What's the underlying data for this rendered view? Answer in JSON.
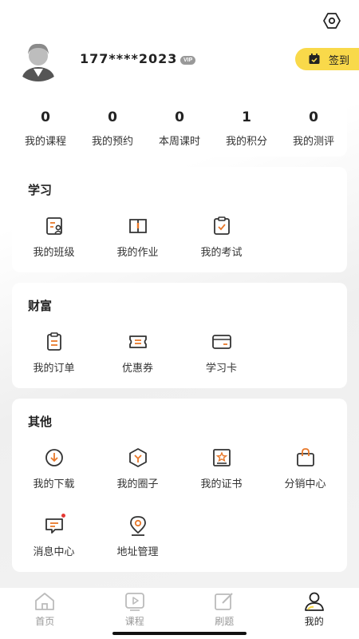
{
  "profile": {
    "username": "177****2023",
    "vip_badge": "VIP",
    "checkin_label": "签到"
  },
  "stats": [
    {
      "value": "0",
      "label": "我的课程"
    },
    {
      "value": "0",
      "label": "我的预约"
    },
    {
      "value": "0",
      "label": "本周课时"
    },
    {
      "value": "1",
      "label": "我的积分"
    },
    {
      "value": "0",
      "label": "我的测评"
    }
  ],
  "study": {
    "title": "学习",
    "items": [
      {
        "label": "我的班级",
        "icon": "class-icon"
      },
      {
        "label": "我的作业",
        "icon": "homework-icon"
      },
      {
        "label": "我的考试",
        "icon": "exam-icon"
      }
    ]
  },
  "wealth": {
    "title": "财富",
    "items": [
      {
        "label": "我的订单",
        "icon": "order-icon"
      },
      {
        "label": "优惠券",
        "icon": "coupon-icon"
      },
      {
        "label": "学习卡",
        "icon": "card-icon"
      }
    ]
  },
  "other": {
    "title": "其他",
    "items": [
      {
        "label": "我的下载",
        "icon": "download-icon"
      },
      {
        "label": "我的圈子",
        "icon": "circle-icon"
      },
      {
        "label": "我的证书",
        "icon": "certificate-icon"
      },
      {
        "label": "分销中心",
        "icon": "shopping-bag-icon"
      },
      {
        "label": "消息中心",
        "icon": "message-icon"
      },
      {
        "label": "地址管理",
        "icon": "location-icon"
      }
    ]
  },
  "tabbar": [
    {
      "label": "首页",
      "icon": "home-icon",
      "active": false
    },
    {
      "label": "课程",
      "icon": "video-icon",
      "active": false
    },
    {
      "label": "刷题",
      "icon": "edit-icon",
      "active": false
    },
    {
      "label": "我的",
      "icon": "user-icon",
      "active": true
    }
  ],
  "colors": {
    "accent": "#f9d94a",
    "icon_orange": "#e8782a",
    "icon_dark": "#333333",
    "badge_red": "#e53935"
  }
}
